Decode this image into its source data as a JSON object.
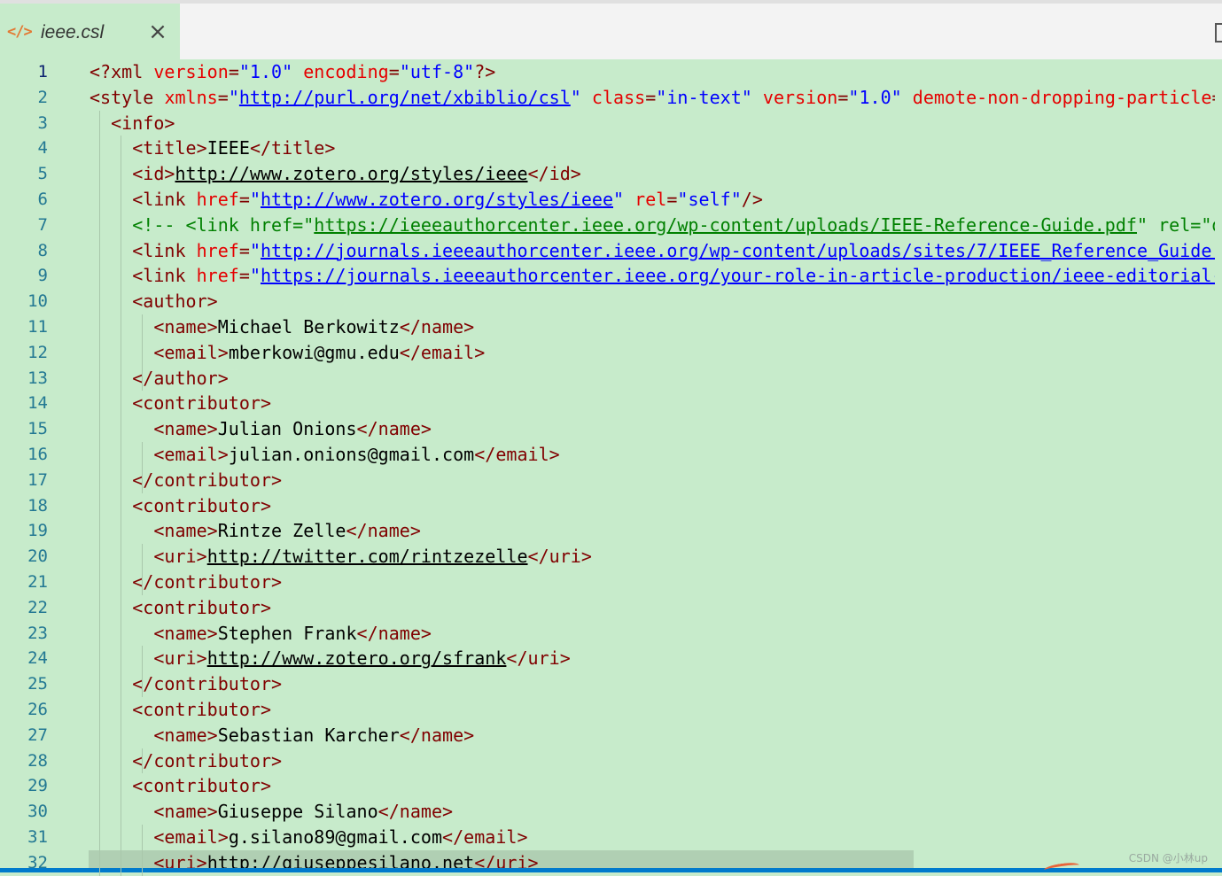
{
  "tab": {
    "icon": "</>",
    "title": "ieee.csl",
    "close": "×"
  },
  "lines": [
    {
      "n": "1",
      "segs": [
        [
          "tag",
          "<?xml "
        ],
        [
          "attr",
          "version"
        ],
        [
          "tag",
          "="
        ],
        [
          "val",
          "\"1.0\""
        ],
        [
          "tag",
          " "
        ],
        [
          "attr",
          "encoding"
        ],
        [
          "tag",
          "="
        ],
        [
          "val",
          "\"utf-8\""
        ],
        [
          "tag",
          "?>"
        ]
      ]
    },
    {
      "n": "2",
      "segs": [
        [
          "tag",
          "<style "
        ],
        [
          "attr",
          "xmlns"
        ],
        [
          "tag",
          "="
        ],
        [
          "val",
          "\""
        ],
        [
          "val link",
          "http://purl.org/net/xbiblio/csl"
        ],
        [
          "val",
          "\""
        ],
        [
          "tag",
          " "
        ],
        [
          "attr",
          "class"
        ],
        [
          "tag",
          "="
        ],
        [
          "val",
          "\"in-text\""
        ],
        [
          "tag",
          " "
        ],
        [
          "attr",
          "version"
        ],
        [
          "tag",
          "="
        ],
        [
          "val",
          "\"1.0\""
        ],
        [
          "tag",
          " "
        ],
        [
          "attr",
          "demote-non-dropping-particle"
        ],
        [
          "tag",
          "=\""
        ]
      ]
    },
    {
      "n": "3",
      "segs": [
        [
          "",
          "  "
        ],
        [
          "tag",
          "<info>"
        ]
      ]
    },
    {
      "n": "4",
      "segs": [
        [
          "",
          "    "
        ],
        [
          "tag",
          "<title>"
        ],
        [
          "",
          "IEEE"
        ],
        [
          "tag",
          "</title>"
        ]
      ]
    },
    {
      "n": "5",
      "segs": [
        [
          "",
          "    "
        ],
        [
          "tag",
          "<id>"
        ],
        [
          "link",
          "http://www.zotero.org/styles/ieee"
        ],
        [
          "tag",
          "</id>"
        ]
      ]
    },
    {
      "n": "6",
      "segs": [
        [
          "",
          "    "
        ],
        [
          "tag",
          "<link "
        ],
        [
          "attr",
          "href"
        ],
        [
          "tag",
          "="
        ],
        [
          "val",
          "\""
        ],
        [
          "val link",
          "http://www.zotero.org/styles/ieee"
        ],
        [
          "val",
          "\""
        ],
        [
          "tag",
          " "
        ],
        [
          "attr",
          "rel"
        ],
        [
          "tag",
          "="
        ],
        [
          "val",
          "\"self\""
        ],
        [
          "tag",
          "/>"
        ]
      ]
    },
    {
      "n": "7",
      "segs": [
        [
          "",
          "    "
        ],
        [
          "comment",
          "<!-- <link href=\""
        ],
        [
          "comment link",
          "https://ieeeauthorcenter.ieee.org/wp-content/uploads/IEEE-Reference-Guide.pdf"
        ],
        [
          "comment",
          "\" rel=\"do"
        ]
      ]
    },
    {
      "n": "8",
      "segs": [
        [
          "",
          "    "
        ],
        [
          "tag",
          "<link "
        ],
        [
          "attr",
          "href"
        ],
        [
          "tag",
          "="
        ],
        [
          "val",
          "\""
        ],
        [
          "val link",
          "http://journals.ieeeauthorcenter.ieee.org/wp-content/uploads/sites/7/IEEE_Reference_Guide.p"
        ]
      ]
    },
    {
      "n": "9",
      "segs": [
        [
          "",
          "    "
        ],
        [
          "tag",
          "<link "
        ],
        [
          "attr",
          "href"
        ],
        [
          "tag",
          "="
        ],
        [
          "val",
          "\""
        ],
        [
          "val link",
          "https://journals.ieeeauthorcenter.ieee.org/your-role-in-article-production/ieee-editorial-s"
        ]
      ]
    },
    {
      "n": "10",
      "segs": [
        [
          "",
          "    "
        ],
        [
          "tag",
          "<author>"
        ]
      ]
    },
    {
      "n": "11",
      "segs": [
        [
          "",
          "      "
        ],
        [
          "tag",
          "<name>"
        ],
        [
          "",
          "Michael Berkowitz"
        ],
        [
          "tag",
          "</name>"
        ]
      ]
    },
    {
      "n": "12",
      "segs": [
        [
          "",
          "      "
        ],
        [
          "tag",
          "<email>"
        ],
        [
          "",
          "mberkowi@gmu.edu"
        ],
        [
          "tag",
          "</email>"
        ]
      ]
    },
    {
      "n": "13",
      "segs": [
        [
          "",
          "    "
        ],
        [
          "tag",
          "</author>"
        ]
      ]
    },
    {
      "n": "14",
      "segs": [
        [
          "",
          "    "
        ],
        [
          "tag",
          "<contributor>"
        ]
      ]
    },
    {
      "n": "15",
      "segs": [
        [
          "",
          "      "
        ],
        [
          "tag",
          "<name>"
        ],
        [
          "",
          "Julian Onions"
        ],
        [
          "tag",
          "</name>"
        ]
      ]
    },
    {
      "n": "16",
      "segs": [
        [
          "",
          "      "
        ],
        [
          "tag",
          "<email>"
        ],
        [
          "",
          "julian.onions@gmail.com"
        ],
        [
          "tag",
          "</email>"
        ]
      ]
    },
    {
      "n": "17",
      "segs": [
        [
          "",
          "    "
        ],
        [
          "tag",
          "</contributor>"
        ]
      ]
    },
    {
      "n": "18",
      "segs": [
        [
          "",
          "    "
        ],
        [
          "tag",
          "<contributor>"
        ]
      ]
    },
    {
      "n": "19",
      "segs": [
        [
          "",
          "      "
        ],
        [
          "tag",
          "<name>"
        ],
        [
          "",
          "Rintze Zelle"
        ],
        [
          "tag",
          "</name>"
        ]
      ]
    },
    {
      "n": "20",
      "segs": [
        [
          "",
          "      "
        ],
        [
          "tag",
          "<uri>"
        ],
        [
          "link",
          "http://twitter.com/rintzezelle"
        ],
        [
          "tag",
          "</uri>"
        ]
      ]
    },
    {
      "n": "21",
      "segs": [
        [
          "",
          "    "
        ],
        [
          "tag",
          "</contributor>"
        ]
      ]
    },
    {
      "n": "22",
      "segs": [
        [
          "",
          "    "
        ],
        [
          "tag",
          "<contributor>"
        ]
      ]
    },
    {
      "n": "23",
      "segs": [
        [
          "",
          "      "
        ],
        [
          "tag",
          "<name>"
        ],
        [
          "",
          "Stephen Frank"
        ],
        [
          "tag",
          "</name>"
        ]
      ]
    },
    {
      "n": "24",
      "segs": [
        [
          "",
          "      "
        ],
        [
          "tag",
          "<uri>"
        ],
        [
          "link",
          "http://www.zotero.org/sfrank"
        ],
        [
          "tag",
          "</uri>"
        ]
      ]
    },
    {
      "n": "25",
      "segs": [
        [
          "",
          "    "
        ],
        [
          "tag",
          "</contributor>"
        ]
      ]
    },
    {
      "n": "26",
      "segs": [
        [
          "",
          "    "
        ],
        [
          "tag",
          "<contributor>"
        ]
      ]
    },
    {
      "n": "27",
      "segs": [
        [
          "",
          "      "
        ],
        [
          "tag",
          "<name>"
        ],
        [
          "",
          "Sebastian Karcher"
        ],
        [
          "tag",
          "</name>"
        ]
      ]
    },
    {
      "n": "28",
      "segs": [
        [
          "",
          "    "
        ],
        [
          "tag",
          "</contributor>"
        ]
      ]
    },
    {
      "n": "29",
      "segs": [
        [
          "",
          "    "
        ],
        [
          "tag",
          "<contributor>"
        ]
      ]
    },
    {
      "n": "30",
      "segs": [
        [
          "",
          "      "
        ],
        [
          "tag",
          "<name>"
        ],
        [
          "",
          "Giuseppe Silano"
        ],
        [
          "tag",
          "</name>"
        ]
      ]
    },
    {
      "n": "31",
      "segs": [
        [
          "",
          "      "
        ],
        [
          "tag",
          "<email>"
        ],
        [
          "",
          "g.silano89@gmail.com"
        ],
        [
          "tag",
          "</email>"
        ]
      ]
    },
    {
      "n": "32",
      "segs": [
        [
          "",
          "      "
        ],
        [
          "tag",
          "<uri>"
        ],
        [
          "",
          "http://giuseppesilano.net"
        ],
        [
          "tag",
          "</uri>"
        ]
      ]
    }
  ],
  "active_line": "1",
  "highlight_line": "32",
  "watermark": "CSDN @小林up",
  "colors": {
    "background": "#c7ebcb",
    "tag": "#800000",
    "attribute": "#e50000",
    "value": "#0000ff",
    "comment": "#008000",
    "line_number": "#237893"
  }
}
